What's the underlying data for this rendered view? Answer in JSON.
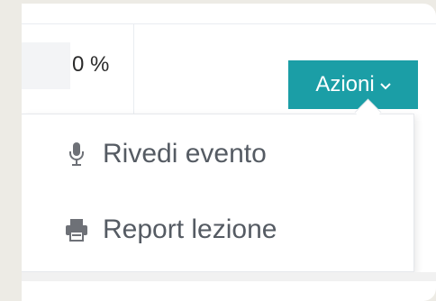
{
  "table_row": {
    "percent_label": "0 %",
    "progress_value": 0
  },
  "actions_button": {
    "label": "Azioni"
  },
  "dropdown_menu": {
    "items": [
      {
        "label": "Rivedi evento",
        "icon": "microphone-icon"
      },
      {
        "label": "Report lezione",
        "icon": "printer-icon"
      }
    ]
  },
  "colors": {
    "accent": "#1b9ea6",
    "menu_text": "#555b63",
    "icon": "#6e7177"
  }
}
